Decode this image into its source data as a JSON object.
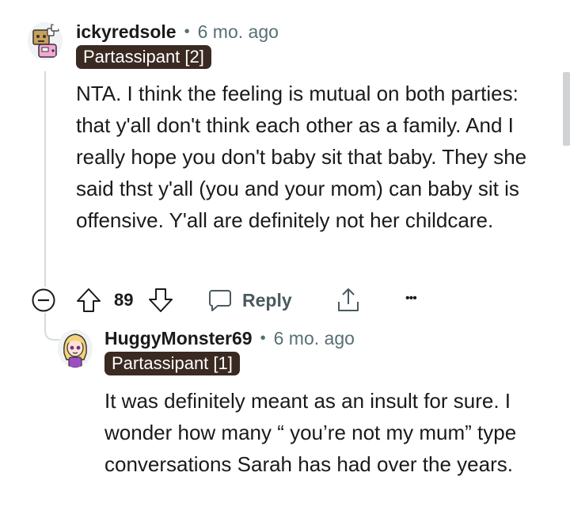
{
  "comment": {
    "username": "ickyredsole",
    "separator": "•",
    "time": "6 mo. ago",
    "flair": "Partassipant [2]",
    "body": "NTA. I think the feeling is mutual on both parties: that y'all don't think each other as a family. And I really hope you don't baby sit that baby. They she said thst y'all (you and your mom) can baby sit is offensive. Y'all are definitely not her childcare.",
    "avatar_icon": "robot-avatar-icon",
    "actions": {
      "collapse_icon": "collapse-minus-icon",
      "upvote_icon": "upvote-arrow-icon",
      "score": "89",
      "downvote_icon": "downvote-arrow-icon",
      "reply_icon": "speech-bubble-icon",
      "reply_label": "Reply",
      "share_icon": "share-icon",
      "more_label": "•••"
    }
  },
  "reply": {
    "username": "HuggyMonster69",
    "separator": "•",
    "time": "6 mo. ago",
    "flair": "Partassipant [1]",
    "body": "It was definitely meant as an insult for sure. I wonder how many “ you’re not my mum” type conversations Sarah has had over the years.",
    "avatar_icon": "blonde-girl-avatar-icon"
  },
  "colors": {
    "flair_bg": "#3a2a22",
    "muted_text": "#576f76",
    "thread_line": "#d7dadc"
  }
}
